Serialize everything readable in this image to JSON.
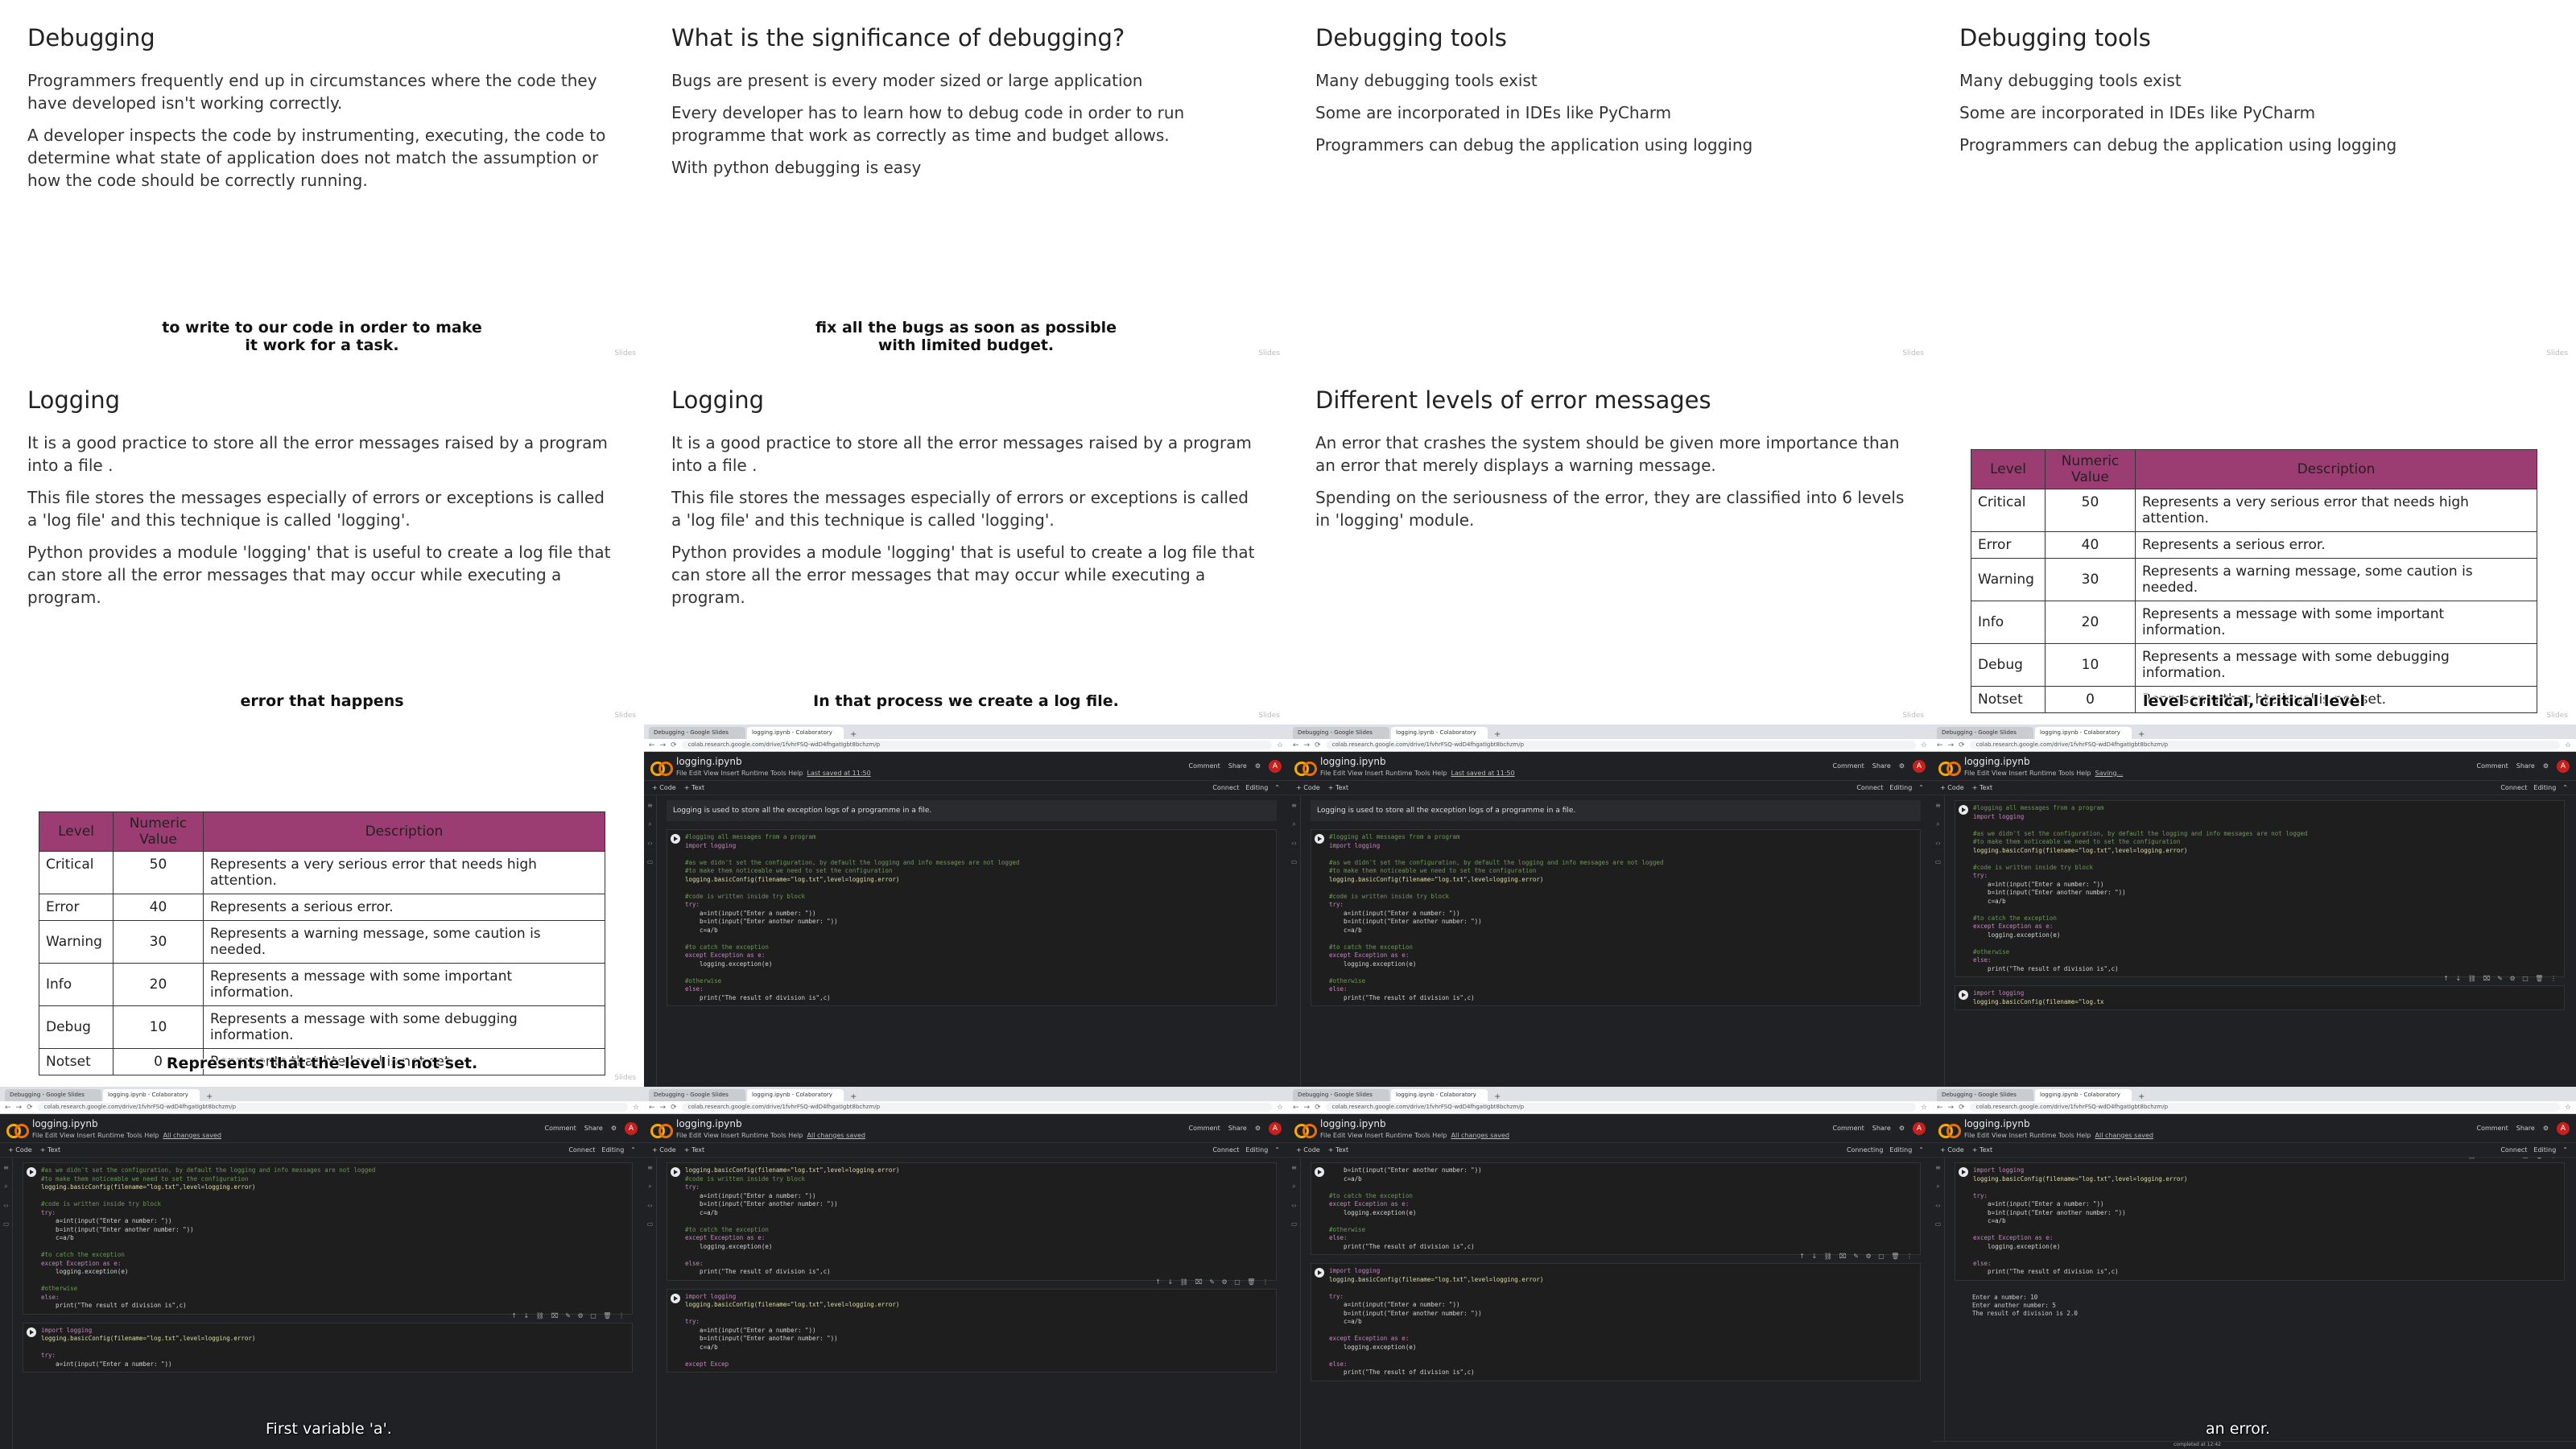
{
  "slides": [
    {
      "title": "Debugging",
      "paras": [
        "Programmers frequently end up in circumstances where the code they have developed isn't working correctly.",
        "A developer inspects the code by instrumenting, executing, the code to determine what state of application does not match the assumption or how the code should be correctly running."
      ],
      "caption_line1": "to write to our code in order to make",
      "caption_line2": "it work for a task."
    },
    {
      "title": "What is the significance of debugging?",
      "paras": [
        "Bugs are present is every moder sized or large application",
        "Every developer has to learn how to debug code in order to run programme that work as correctly as time and budget allows.",
        "With python debugging is easy"
      ],
      "caption_line1": "fix all the bugs as soon as possible",
      "caption_line2": "with limited budget."
    },
    {
      "title": "Debugging tools",
      "paras": [
        "Many debugging tools exist",
        "Some are incorporated in IDEs like PyCharm",
        "Programmers can debug the application using logging"
      ]
    },
    {
      "title": "Debugging tools",
      "paras": [
        "Many debugging tools exist",
        "Some are incorporated in IDEs like PyCharm",
        "Programmers can debug the application using logging"
      ]
    },
    {
      "title": "Logging",
      "paras": [
        "It is a good practice to store all the error messages raised by a program into a file .",
        "This file stores the messages especially of errors or exceptions is called a 'log file' and this technique is called 'logging'.",
        "Python provides a module 'logging' that is useful to create a log file that can store all the error messages that may occur while executing a program."
      ],
      "caption": "error that happens"
    },
    {
      "title": "Logging",
      "paras": [
        "It is a good practice to store all the error messages raised by a program into a file .",
        "This file stores the messages especially of errors or exceptions is called a 'log file' and this technique is called 'logging'.",
        "Python provides a module 'logging' that is useful to create a log file that can store all the error messages that may occur while executing a program."
      ],
      "caption": "In that process we create a log file."
    },
    {
      "title": "Different levels of error messages",
      "paras": [
        "An error that crashes the system should be given more importance than an error that merely displays a warning message.",
        "Spending on the seriousness of the error, they are classified into 6 levels in 'logging' module."
      ]
    }
  ],
  "table": {
    "headers": [
      "Level",
      "Numeric Value",
      "Description"
    ],
    "rows": [
      [
        "Critical",
        "50",
        "Represents a very serious error that needs high attention."
      ],
      [
        "Error",
        "40",
        "Represents a serious error."
      ],
      [
        "Warning",
        "30",
        "Represents a warning message, some caution is needed."
      ],
      [
        "Info",
        "20",
        "Represents a message with some important information."
      ],
      [
        "Debug",
        "10",
        "Represents a message with some debugging information."
      ],
      [
        "Notset",
        "0",
        "Represents that hte level is not set."
      ]
    ],
    "caption_a": "level critical, critical level",
    "caption_b": "Represents that the level is not set."
  },
  "watermark": "Slides",
  "browser": {
    "tab1": "Debugging - Google Slides",
    "tab2": "logging.ipynb - Colaboratory",
    "plus": "+",
    "url": "colab.research.google.com/drive/1fvhrFSQ-wdD4fhgatIgbt8bchzm/p",
    "filename": "logging.ipynb",
    "menus": "File  Edit  View  Insert  Runtime  Tools  Help",
    "saved_a": "Last saved at 11:50",
    "saved_b": "All changes saved",
    "saved_c": "Saving...",
    "comment": "Comment",
    "share": "Share",
    "avatar": "A",
    "code_btn": "+ Code",
    "text_btn": "+ Text",
    "connect": "Connect",
    "connecting": "Connecting",
    "editing": "Editing",
    "textcell": "Logging is used to store all the exception logs of a programme in a file.",
    "toolbar_icons": "↑ ↓ ⛓ ⌧ ✎ ⚙ ▢ 🗑 ⋮",
    "status": "completed at 12:42"
  },
  "code": {
    "c1": "#logging all messages from a program",
    "c2": "import logging",
    "c3": "#as we didn't set the configuration, by default the logging and info messages are not logged",
    "c4": "#to make them noticeable we need to set the configuration",
    "c5": "logging.basicConfig(filename=\"log.txt\",level=logging.error)",
    "c6": "#code is written inside try block",
    "c7": "try:",
    "c8": "    a=int(input(\"Enter a number: \"))",
    "c9": "    b=int(input(\"Enter another number: \"))",
    "c10": "    c=a/b",
    "c11": "#to catch the exception",
    "c12": "except Exception as e:",
    "c13": "    logging.exception(e)",
    "c14": "#otherwise",
    "c15": "else:",
    "c16": "    print(\"The result of division is\",c)",
    "d1": "import logging",
    "d2": "logging.basicConfig(filename=\"log.txt\",level=logging.error)",
    "d3": "except Excep",
    "d4": "logging.basicConfig(filename=\"log.tx",
    "o1": "Enter a number: 10",
    "o2": "Enter another number: 5",
    "o3": "The result of division is 2.0"
  },
  "screen_captions": {
    "a": "First variable 'a'.",
    "b": "an error."
  }
}
